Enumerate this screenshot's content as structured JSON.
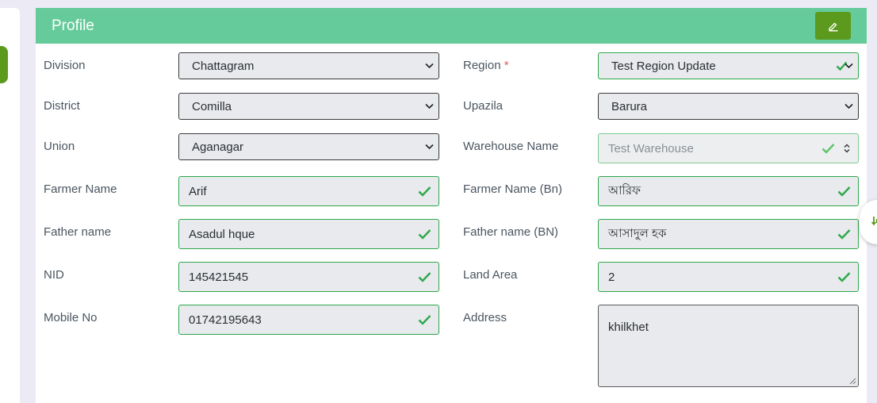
{
  "card": {
    "title": "Profile",
    "edit_icon": "pencil-icon",
    "header_color": "#66cb9a",
    "button_color": "#5c9a1e"
  },
  "form": {
    "division": {
      "label": "Division",
      "value": "Chattagram"
    },
    "region": {
      "label": "Region",
      "required_mark": "*",
      "value": "Test Region Update"
    },
    "district": {
      "label": "District",
      "value": "Comilla"
    },
    "upazila": {
      "label": "Upazila",
      "value": "Barura"
    },
    "union": {
      "label": "Union",
      "value": "Aganagar"
    },
    "warehouse_name": {
      "label": "Warehouse Name",
      "value": "Test Warehouse"
    },
    "farmer_name": {
      "label": "Farmer Name",
      "value": "Arif"
    },
    "farmer_name_bn": {
      "label": "Farmer Name (Bn)",
      "value": "আরিফ"
    },
    "father_name": {
      "label": "Father name",
      "value": "Asadul hque"
    },
    "father_name_bn": {
      "label": "Father name (BN)",
      "value": "আসাদুল হক"
    },
    "nid": {
      "label": "NID",
      "value": "145421545"
    },
    "land_area": {
      "label": "Land Area",
      "value": "2"
    },
    "mobile_no": {
      "label": "Mobile No",
      "value": "01742195643"
    },
    "address": {
      "label": "Address",
      "value": "khilkhet"
    }
  },
  "icons": {
    "valid": "check-icon",
    "dropdown": "chevron-down-icon",
    "scroll": "arrow-down-icon"
  },
  "colors": {
    "valid": "#2ea84a",
    "required": "#e05a5a"
  }
}
